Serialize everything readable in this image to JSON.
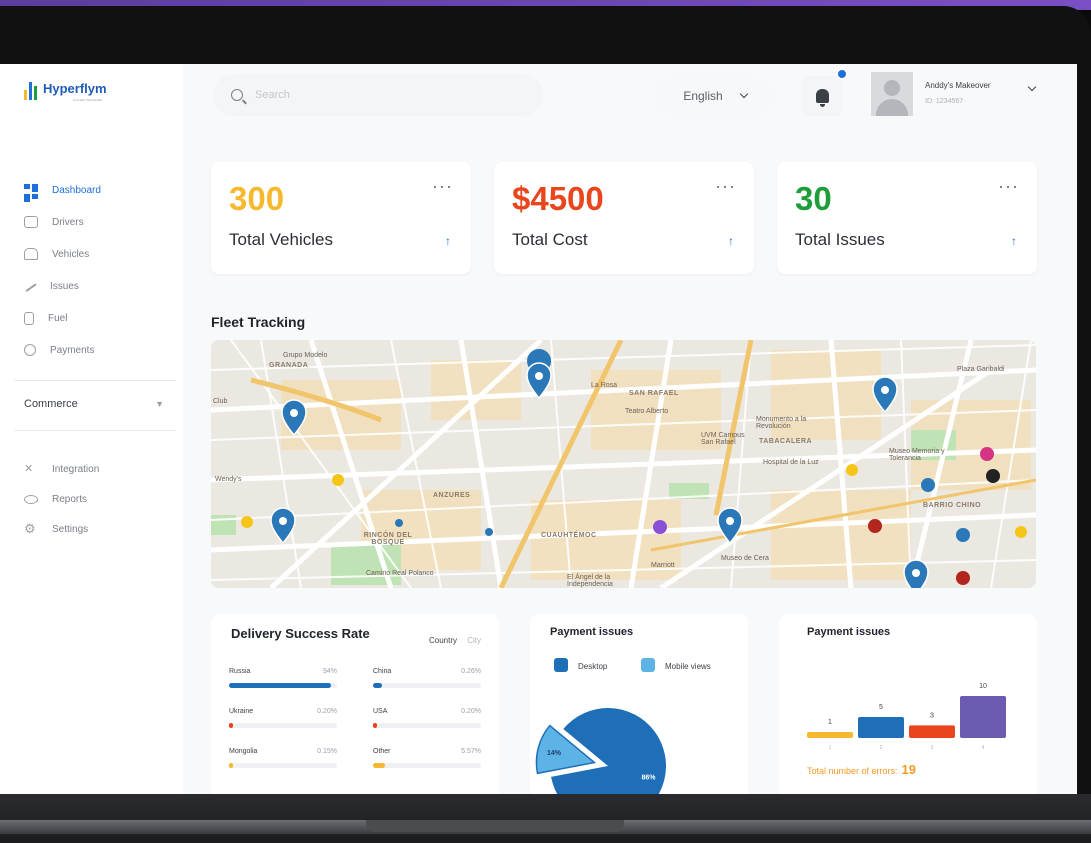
{
  "brand": {
    "name": "Hyperflym",
    "tagline": "AI FLEET MANAGER"
  },
  "nav": {
    "items": [
      {
        "label": "Dashboard",
        "icon": "dashboard-icon"
      },
      {
        "label": "Drivers",
        "icon": "drivers-icon"
      },
      {
        "label": "Vehicles",
        "icon": "vehicle-icon"
      },
      {
        "label": "Issues",
        "icon": "issues-icon"
      },
      {
        "label": "Fuel",
        "icon": "fuel-icon"
      },
      {
        "label": "Payments",
        "icon": "payments-icon"
      }
    ],
    "commerce": "Commerce",
    "secondary": [
      {
        "label": "Integration",
        "icon": "integration-icon"
      },
      {
        "label": "Reports",
        "icon": "reports-icon"
      },
      {
        "label": "Settings",
        "icon": "settings-icon"
      }
    ]
  },
  "topbar": {
    "search_placeholder": "Search",
    "language": "English",
    "user_name": "Anddy's Makeover",
    "user_id": "ID: 1234567"
  },
  "stats": [
    {
      "value": "300",
      "label": "Total Vehicles",
      "color": "#f5b82e"
    },
    {
      "value": "$4500",
      "label": "Total Cost",
      "color": "#e9461e"
    },
    {
      "value": "30",
      "label": "Total Issues",
      "color": "#1f9d3a"
    }
  ],
  "fleet": {
    "title": "Fleet Tracking",
    "map_labels": [
      "Grupo Modelo",
      "GRANADA",
      "Club",
      "SAN RAFAEL",
      "TABACALERA",
      "ANZURES",
      "RINCÓN DEL BOSQUE",
      "CUAUHTÉMOC",
      "BARRIO CHINO",
      "Camino Real Polanco",
      "Hospital de la Luz",
      "Museo Memoria y Tolerancia",
      "Plaza Garibaldi",
      "Museo de Cera",
      "El Ángel de la Independencia",
      "Teatro Alberto",
      "UVM Campus San Rafael",
      "Monumento a la Revolución",
      "Marriott",
      "Wendy's",
      "La Rosa"
    ]
  },
  "delivery": {
    "title": "Delivery Success Rate",
    "tab_active": "Country",
    "tab_inactive": "City",
    "rows": [
      {
        "label": "Russia",
        "pct": "94%",
        "fill": 0.94,
        "color": "#1e6fb8"
      },
      {
        "label": "China",
        "pct": "0.26%",
        "fill": 0.08,
        "color": "#1e6fb8"
      },
      {
        "label": "Ukraine",
        "pct": "0.20%",
        "fill": 0.03,
        "color": "#e9461e"
      },
      {
        "label": "USA",
        "pct": "0.20%",
        "fill": 0.03,
        "color": "#e9461e"
      },
      {
        "label": "Mongolia",
        "pct": "0.15%",
        "fill": 0.02,
        "color": "#f5b82e"
      },
      {
        "label": "Other",
        "pct": "5.57%",
        "fill": 0.11,
        "color": "#f5b82e"
      }
    ]
  },
  "payment_pie": {
    "title": "Payment issues",
    "legend": [
      {
        "label": "Desktop",
        "color": "#1e6fb8"
      },
      {
        "label": "Mobile views",
        "color": "#5eb3e6"
      }
    ],
    "slices": [
      {
        "label": "86%",
        "value": 86,
        "color": "#1e6fb8"
      },
      {
        "label": "14%",
        "value": 14,
        "color": "#5eb3e6"
      }
    ]
  },
  "payment_bars": {
    "title": "Payment issues",
    "total_label": "Total number of errors:",
    "total_value": "19"
  },
  "chart_data": {
    "type": "bar",
    "categories": [
      "1",
      "2",
      "3",
      "4"
    ],
    "values": [
      1,
      5,
      3,
      10
    ],
    "colors": [
      "#f5b82e",
      "#1e6fb8",
      "#e9461e",
      "#6a5bb0"
    ],
    "ylim": [
      0,
      10
    ]
  }
}
